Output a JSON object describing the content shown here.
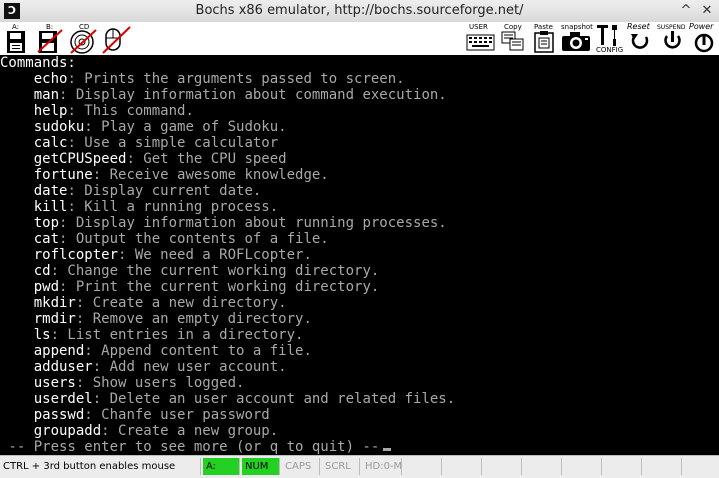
{
  "window": {
    "title": "Bochs x86 emulator, http://bochs.sourceforge.net/",
    "app_icon_glyph": "Ɔ",
    "controls": [
      "^",
      "✕"
    ]
  },
  "toolbar": {
    "left": [
      {
        "icon": "floppy-a-icon",
        "label": "A:"
      },
      {
        "icon": "floppy-b-icon",
        "label": "B:"
      },
      {
        "icon": "cdrom-icon",
        "label": "CD"
      },
      {
        "icon": "mouse-icon",
        "label": ""
      }
    ],
    "right": [
      {
        "icon": "keyboard-icon",
        "label": "USER"
      },
      {
        "icon": "copy-icon",
        "label": "Copy"
      },
      {
        "icon": "paste-icon",
        "label": "Paste"
      },
      {
        "icon": "camera-icon",
        "label": "snapshot"
      },
      {
        "icon": "config-icon",
        "label": "CONFIG"
      },
      {
        "icon": "reset-icon",
        "label": "Reset"
      },
      {
        "icon": "suspend-icon",
        "label": "SUSPEND"
      },
      {
        "icon": "power-icon",
        "label": "Power"
      }
    ]
  },
  "console": {
    "header": "Commands:",
    "commands": [
      {
        "name": "echo",
        "desc": ": Prints the arguments passed to screen."
      },
      {
        "name": "man",
        "desc": ": Display information about command execution."
      },
      {
        "name": "help",
        "desc": ": This command."
      },
      {
        "name": "sudoku",
        "desc": ": Play a game of Sudoku."
      },
      {
        "name": "calc",
        "desc": ": Use a simple calculator"
      },
      {
        "name": "getCPUSpeed",
        "desc": ": Get the CPU speed"
      },
      {
        "name": "fortune",
        "desc": ": Receive awesome knowledge."
      },
      {
        "name": "date",
        "desc": ": Display current date."
      },
      {
        "name": "kill",
        "desc": ": Kill a running process."
      },
      {
        "name": "top",
        "desc": ": Display information about running processes."
      },
      {
        "name": "cat",
        "desc": ": Output the contents of a file."
      },
      {
        "name": "roflcopter",
        "desc": ": We need a ROFLcopter."
      },
      {
        "name": "cd",
        "desc": ": Change the current working directory."
      },
      {
        "name": "pwd",
        "desc": ": Print the current working directory."
      },
      {
        "name": "mkdir",
        "desc": ": Create a new directory."
      },
      {
        "name": "rmdir",
        "desc": ": Remove an empty directory."
      },
      {
        "name": "ls",
        "desc": ": List entries in a directory."
      },
      {
        "name": "append",
        "desc": ": Append content to a file."
      },
      {
        "name": "adduser",
        "desc": ": Add new user account."
      },
      {
        "name": "users",
        "desc": ": Show users logged."
      },
      {
        "name": "userdel",
        "desc": ": Delete an user account and related files."
      },
      {
        "name": "passwd",
        "desc": ": Chanfe user password"
      },
      {
        "name": "groupadd",
        "desc": ": Create a new group."
      }
    ],
    "prompt": " -- Press enter to see more (or q to quit) --"
  },
  "statusbar": {
    "mouse_hint": "CTRL + 3rd button enables mouse",
    "fields": [
      "A:",
      "NUM",
      "CAPS",
      "SCRL",
      "HD:0-M"
    ],
    "active_color": "#23d123"
  }
}
